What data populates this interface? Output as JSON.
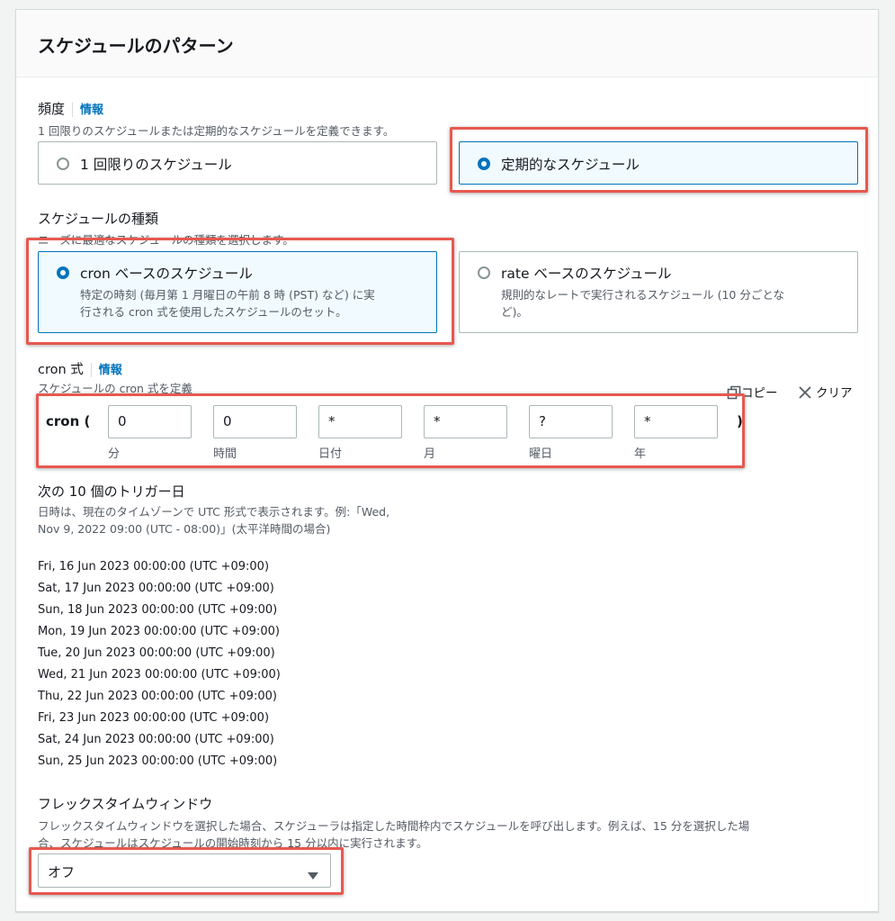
{
  "title": "スケジュールのパターン",
  "frequency": {
    "label": "頻度",
    "info": "情報",
    "description": "1 回限りのスケジュールまたは定期的なスケジュールを定義できます。",
    "options": [
      {
        "label": "1 回限りのスケジュール",
        "selected": false
      },
      {
        "label": "定期的なスケジュール",
        "selected": true
      }
    ]
  },
  "schedule_type": {
    "label": "スケジュールの種類",
    "description": "ニーズに最適なスケジュールの種類を選択します。",
    "options": [
      {
        "label": "cron ベースのスケジュール",
        "description_line1": "特定の時刻 (毎月第 1 月曜日の午前 8 時 (PST) など) に実",
        "description_line2": "行される cron 式を使用したスケジュールのセット。",
        "selected": true
      },
      {
        "label": "rate ベースのスケジュール",
        "description_line1": "規則的なレートで実行されるスケジュール (10 分ごとな",
        "description_line2": "ど)。",
        "selected": false
      }
    ]
  },
  "cron": {
    "label": "cron 式",
    "info": "情報",
    "description": "スケジュールの cron 式を定義",
    "copy_label": "コピー",
    "clear_label": "クリア",
    "prefix": "cron (",
    "suffix": ")",
    "fields": [
      {
        "value": "0",
        "label": "分"
      },
      {
        "value": "0",
        "label": "時間"
      },
      {
        "value": "*",
        "label": "日付"
      },
      {
        "value": "*",
        "label": "月"
      },
      {
        "value": "?",
        "label": "曜日"
      },
      {
        "value": "*",
        "label": "年"
      }
    ]
  },
  "triggers": {
    "heading": "次の 10 個のトリガー日",
    "description_line1": "日時は、現在のタイムゾーンで UTC 形式で表示されます。例:「Wed,",
    "description_line2": "Nov 9, 2022 09:00 (UTC - 08:00)」(太平洋時間の場合)",
    "dates": [
      "Fri, 16 Jun 2023 00:00:00 (UTC +09:00)",
      "Sat, 17 Jun 2023 00:00:00 (UTC +09:00)",
      "Sun, 18 Jun 2023 00:00:00 (UTC +09:00)",
      "Mon, 19 Jun 2023 00:00:00 (UTC +09:00)",
      "Tue, 20 Jun 2023 00:00:00 (UTC +09:00)",
      "Wed, 21 Jun 2023 00:00:00 (UTC +09:00)",
      "Thu, 22 Jun 2023 00:00:00 (UTC +09:00)",
      "Fri, 23 Jun 2023 00:00:00 (UTC +09:00)",
      "Sat, 24 Jun 2023 00:00:00 (UTC +09:00)",
      "Sun, 25 Jun 2023 00:00:00 (UTC +09:00)"
    ]
  },
  "flex_window": {
    "label": "フレックスタイムウィンドウ",
    "description_line1": "フレックスタイムウィンドウを選択した場合、スケジューラは指定した時間枠内でスケジュールを呼び出します。例えば、15 分を選択した場",
    "description_line2": "合、スケジュールはスケジュールの開始時刻から 15 分以内に実行されます。",
    "selected_value": "オフ"
  },
  "colors": {
    "accent": "#0073bb",
    "highlight": "#e8584f"
  },
  "icons": {
    "copy": "copy-icon",
    "clear": "close-icon",
    "dropdown": "caret-down-icon"
  }
}
